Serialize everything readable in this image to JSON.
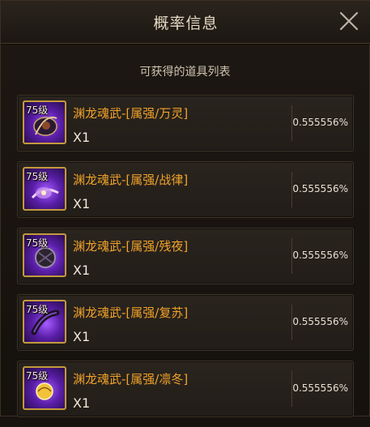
{
  "header": {
    "title": "概率信息"
  },
  "subtitle": "可获得的道具列表",
  "items": [
    {
      "level": "75级",
      "name": "渊龙魂武-[属强/万灵]",
      "quantity": "X1",
      "probability": "0.555556%"
    },
    {
      "level": "75级",
      "name": "渊龙魂武-[属强/战律]",
      "quantity": "X1",
      "probability": "0.555556%"
    },
    {
      "level": "75级",
      "name": "渊龙魂武-[属强/残夜]",
      "quantity": "X1",
      "probability": "0.555556%"
    },
    {
      "level": "75级",
      "name": "渊龙魂武-[属强/复苏]",
      "quantity": "X1",
      "probability": "0.555556%"
    },
    {
      "level": "75级",
      "name": "渊龙魂武-[属强/凛冬]",
      "quantity": "X1",
      "probability": "0.555556%"
    }
  ],
  "colors": {
    "item_name": "#f0a22a",
    "icon_border": "#c49a3c",
    "icon_glow": "#a65cff"
  },
  "icons": {
    "close": "close-icon",
    "item": "soul-weapon-icon"
  }
}
